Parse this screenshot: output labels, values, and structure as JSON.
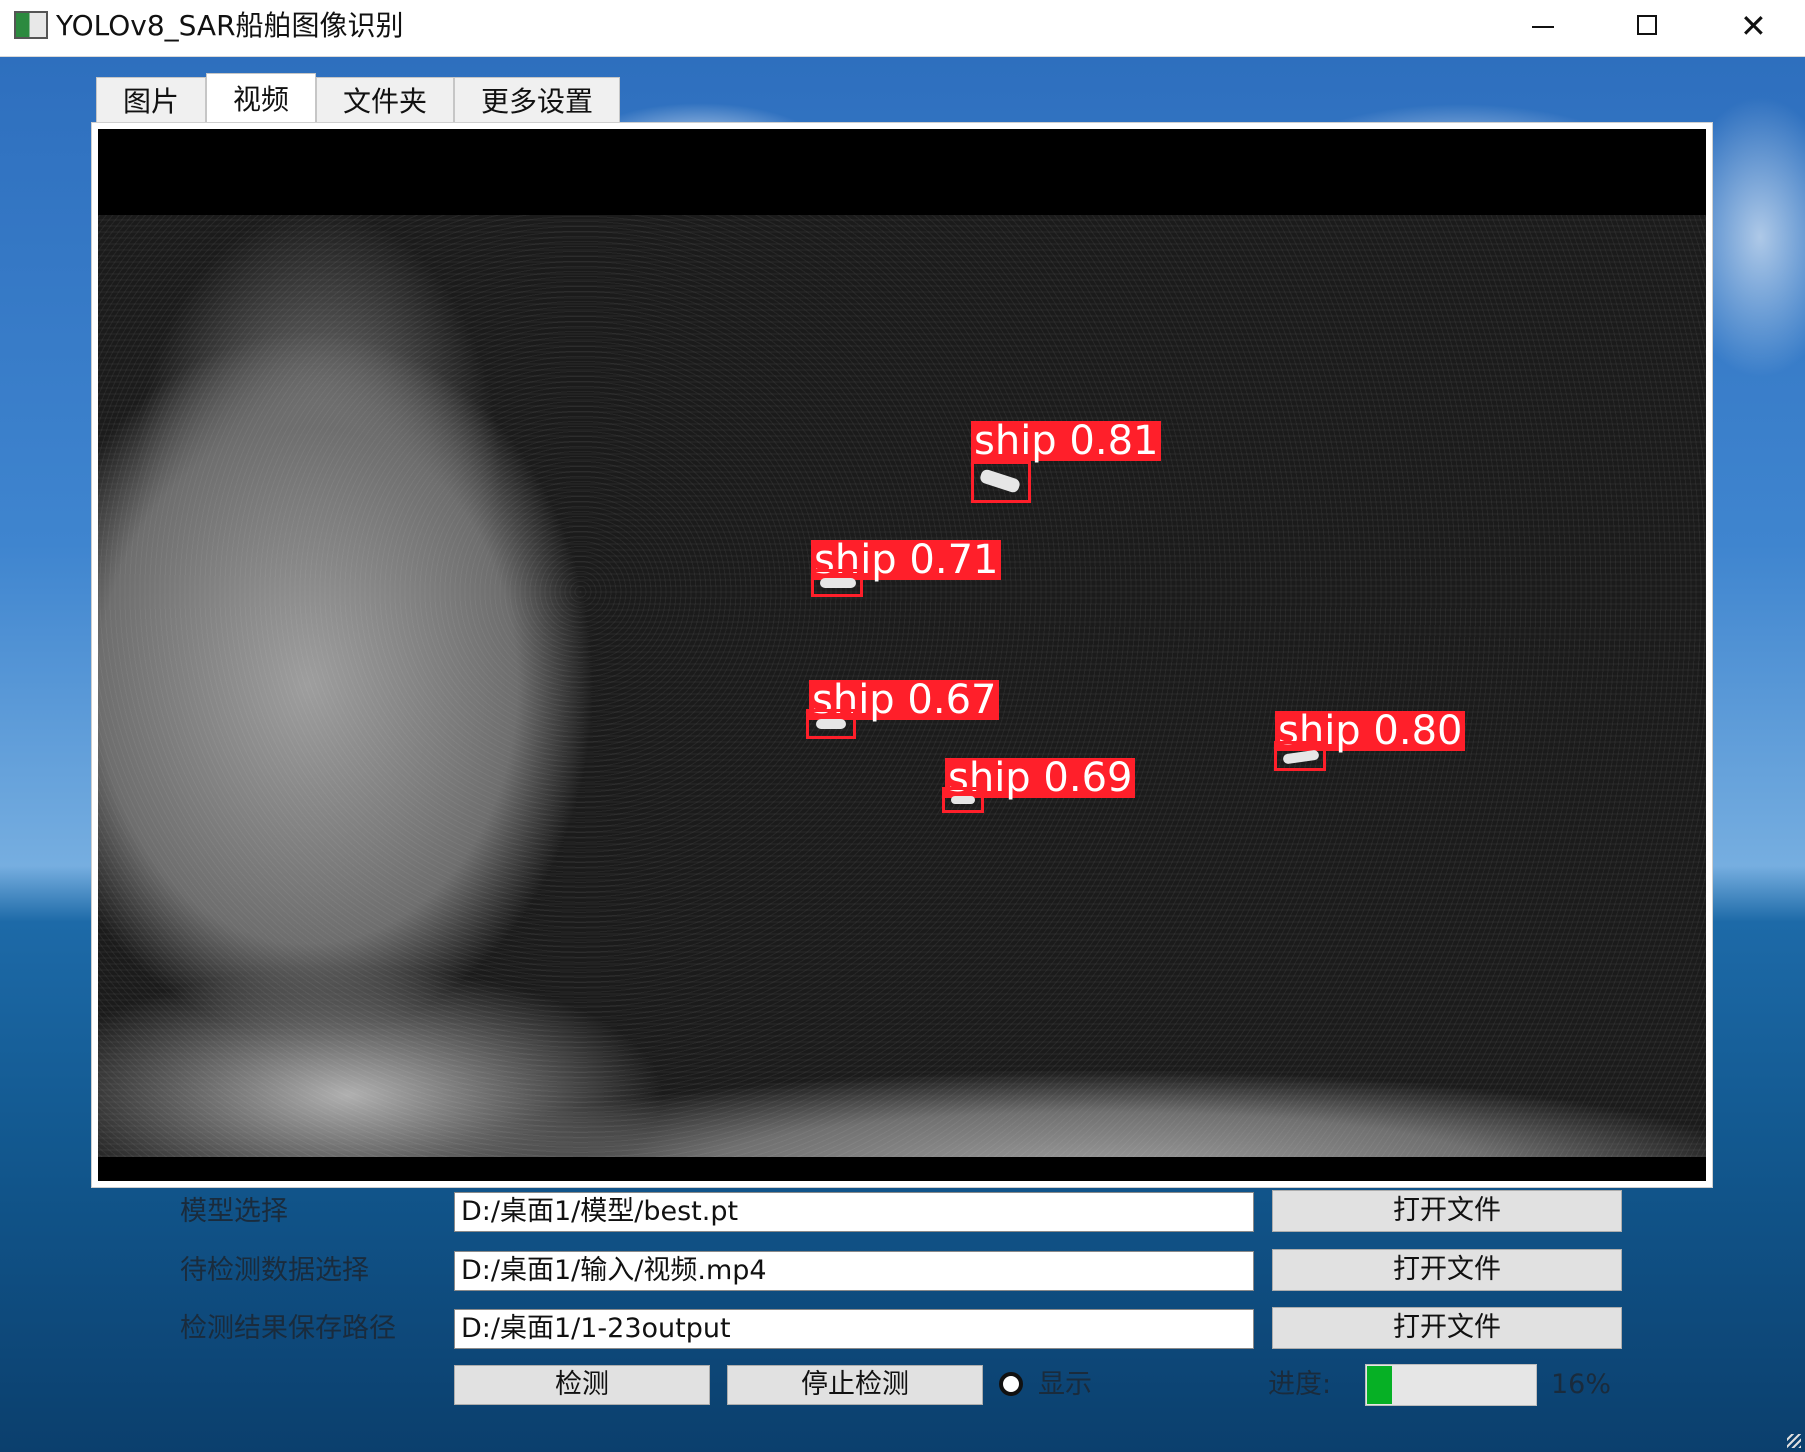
{
  "window": {
    "title": "YOLOv8_SAR船舶图像识别",
    "minimize_icon": "minimize-icon",
    "maximize_icon": "maximize-icon",
    "close_icon": "close-icon",
    "close_glyph": "✕"
  },
  "tabs": [
    {
      "label": "图片",
      "active": false
    },
    {
      "label": "视频",
      "active": true
    },
    {
      "label": "文件夹",
      "active": false
    },
    {
      "label": "更多设置",
      "active": false
    }
  ],
  "detections": [
    {
      "label": "ship 0.81",
      "confidence": 0.81
    },
    {
      "label": "ship 0.71",
      "confidence": 0.71
    },
    {
      "label": "ship 0.67",
      "confidence": 0.67
    },
    {
      "label": "ship 0.80",
      "confidence": 0.8
    },
    {
      "label": "ship 0.69",
      "confidence": 0.69
    }
  ],
  "form": {
    "model": {
      "label": "模型选择",
      "value": "D:/桌面1/模型/best.pt",
      "button": "打开文件"
    },
    "input": {
      "label": "待检测数据选择",
      "value": "D:/桌面1/输入/视频.mp4",
      "button": "打开文件"
    },
    "output": {
      "label": "检测结果保存路径",
      "value": "D:/桌面1/1-23output",
      "button": "打开文件"
    }
  },
  "controls": {
    "detect_label": "检测",
    "stop_label": "停止检测",
    "show_label": "显示",
    "progress_label": "进度:",
    "progress_value": 16,
    "progress_text": "16%"
  },
  "colors": {
    "detection_box": "#ff1f2a",
    "progress_fill": "#06b025"
  }
}
